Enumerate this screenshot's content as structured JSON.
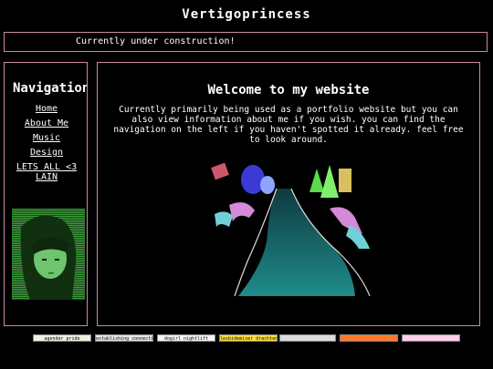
{
  "site": {
    "title": "Vertigoprincess"
  },
  "banner": {
    "text": "Currently under construction!"
  },
  "sidebar": {
    "title": "Navigation",
    "links": [
      {
        "label": "Home"
      },
      {
        "label": "About Me"
      },
      {
        "label": "Music"
      },
      {
        "label": "Design"
      },
      {
        "label": "LETS ALL <3 LAIN"
      }
    ]
  },
  "main": {
    "heading": "Welcome to my website",
    "intro": "Currently primarily being used as a portfolio website but you can also view information about me if you wish. you can find the navigation on the left if you haven't spotted it already. feel free to look around."
  },
  "footer_buttons": [
    {
      "label": "agender pride",
      "color": "#f0f0e0"
    },
    {
      "label": "establishing connection",
      "color": "#e8e8e8"
    },
    {
      "label": "dogirl nightlift",
      "color": "#f4f4f4"
    },
    {
      "label": "lesbidemiser drachten",
      "color": "#ffe040"
    },
    {
      "label": "",
      "color": "#dcdcdc"
    },
    {
      "label": "",
      "color": "#ff7a2a"
    },
    {
      "label": "",
      "color": "#ffd0ea"
    }
  ],
  "colors": {
    "border": "#c98a9c",
    "background": "#000000",
    "text": "#ffffff"
  }
}
